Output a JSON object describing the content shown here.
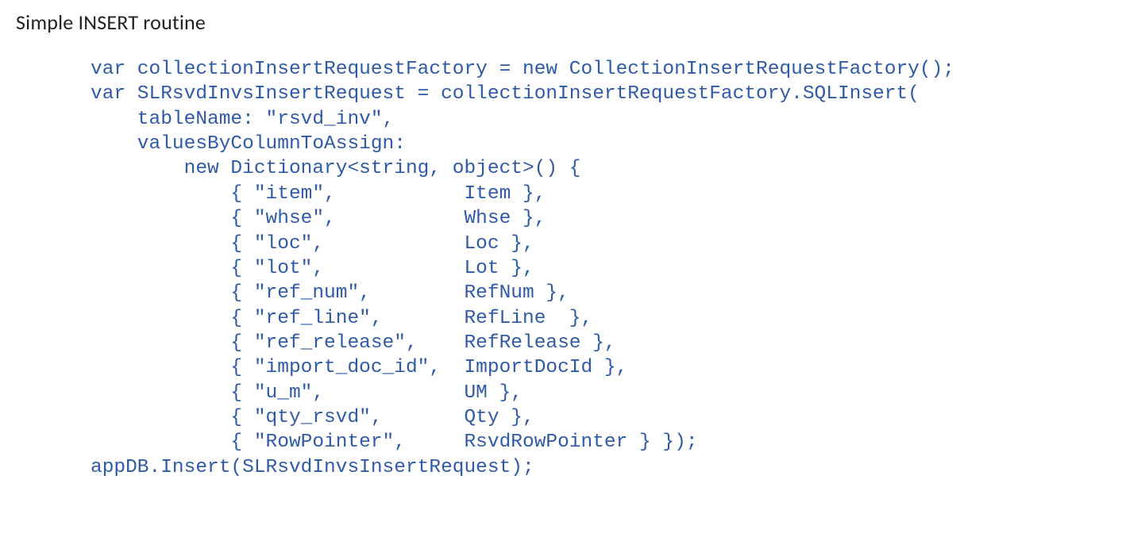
{
  "heading": "Simple INSERT routine",
  "code": {
    "lines": [
      "var collectionInsertRequestFactory = new CollectionInsertRequestFactory();",
      "var SLRsvdInvsInsertRequest = collectionInsertRequestFactory.SQLInsert(",
      "    tableName: \"rsvd_inv\",",
      "    valuesByColumnToAssign:",
      "        new Dictionary<string, object>() {",
      "            { \"item\",           Item },",
      "            { \"whse\",           Whse },",
      "            { \"loc\",            Loc },",
      "            { \"lot\",            Lot },",
      "            { \"ref_num\",        RefNum },",
      "            { \"ref_line\",       RefLine  },",
      "            { \"ref_release\",    RefRelease },",
      "            { \"import_doc_id\",  ImportDocId },",
      "            { \"u_m\",            UM },",
      "            { \"qty_rsvd\",       Qty },",
      "            { \"RowPointer\",     RsvdRowPointer } });",
      "appDB.Insert(SLRsvdInvsInsertRequest);"
    ]
  }
}
